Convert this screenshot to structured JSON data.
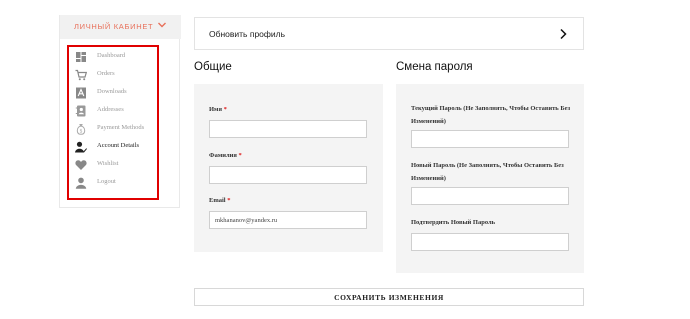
{
  "sidebar": {
    "title": "ЛИЧНЫЙ КАБИНЕТ",
    "items": [
      {
        "label": "Dashboard",
        "icon": "dashboard-icon"
      },
      {
        "label": "Orders",
        "icon": "cart-icon"
      },
      {
        "label": "Downloads",
        "icon": "download-icon"
      },
      {
        "label": "Addresses",
        "icon": "address-book-icon"
      },
      {
        "label": "Payment Methods",
        "icon": "money-bag-icon"
      },
      {
        "label": "Account Details",
        "icon": "user-edit-icon",
        "active": true
      },
      {
        "label": "Wishlist",
        "icon": "heart-icon"
      },
      {
        "label": "Logout",
        "icon": "user-logout-icon"
      }
    ]
  },
  "update_profile": {
    "label": "Обновить профиль"
  },
  "general": {
    "title": "Общие",
    "name_label": "Имя",
    "surname_label": "Фамилия",
    "email_label": "Email",
    "required_mark": "*",
    "name_value": "",
    "surname_value": "",
    "email_value": "mkhananov@yandex.ru"
  },
  "password": {
    "title": "Смена пароля",
    "current_label": "Текущий Пароль (Не Заполнять, Чтобы Оставить Без Изменений)",
    "new_label": "Новый Пароль (Не Заполнять, Чтобы Оставить Без Изменений)",
    "confirm_label": "Подтвердить Новый Пароль"
  },
  "save_button": {
    "label": "СОХРАНИТЬ ИЗМЕНЕНИЯ"
  },
  "colors": {
    "accent": "#e8705a",
    "highlight_border": "#e00000",
    "panel_bg": "#f4f4f4"
  }
}
